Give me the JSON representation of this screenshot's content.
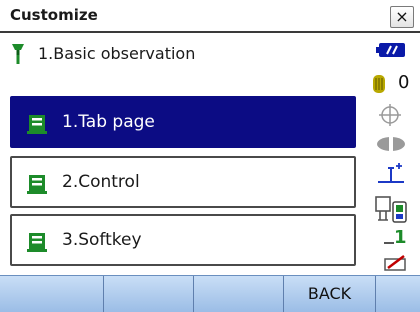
{
  "window": {
    "title": "Customize",
    "close_glyph": "×"
  },
  "breadcrumb": {
    "text": "1.Basic observation",
    "icon": "survey-rod-icon"
  },
  "menu": {
    "items": [
      {
        "label": "1.Tab page",
        "icon": "list-page-icon",
        "selected": true
      },
      {
        "label": "2.Control",
        "icon": "list-page-icon",
        "selected": false
      },
      {
        "label": "3.Softkey",
        "icon": "list-page-icon",
        "selected": false
      }
    ]
  },
  "status": {
    "battery": "battery-icon",
    "coin_count": "0",
    "signal_digit": "1"
  },
  "softkeys": [
    "",
    "",
    "",
    "BACK",
    ""
  ],
  "colors": {
    "selected_bg": "#0c0c84",
    "softkey_bg": "#9fc2ea",
    "icon_green": "#1d8b2a",
    "battery_blue": "#0a1aa8"
  }
}
